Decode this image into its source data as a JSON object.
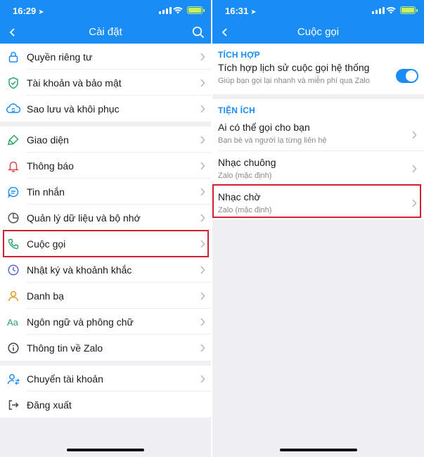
{
  "left": {
    "status": {
      "time": "16:29"
    },
    "title": "Cài đặt",
    "groups": [
      [
        {
          "label": "Quyền riêng tư",
          "icon": "lock-icon"
        },
        {
          "label": "Tài khoản và bảo mật",
          "icon": "shield-icon"
        },
        {
          "label": "Sao lưu và khôi phục",
          "icon": "cloud-sync-icon"
        }
      ],
      [
        {
          "label": "Giao diện",
          "icon": "brush-icon"
        },
        {
          "label": "Thông báo",
          "icon": "bell-icon"
        },
        {
          "label": "Tin nhắn",
          "icon": "chat-icon"
        },
        {
          "label": "Quản lý dữ liệu và bộ nhớ",
          "icon": "clock-storage-icon"
        },
        {
          "label": "Cuộc gọi",
          "icon": "phone-icon"
        },
        {
          "label": "Nhật ký và khoảnh khắc",
          "icon": "history-icon"
        },
        {
          "label": "Danh bạ",
          "icon": "contact-icon"
        },
        {
          "label": "Ngôn ngữ và phông chữ",
          "icon": "font-icon"
        },
        {
          "label": "Thông tin về Zalo",
          "icon": "info-icon"
        }
      ],
      [
        {
          "label": "Chuyển tài khoản",
          "icon": "switch-account-icon"
        },
        {
          "label": "Đăng xuất",
          "icon": "logout-icon"
        }
      ]
    ]
  },
  "right": {
    "status": {
      "time": "16:31"
    },
    "title": "Cuộc gọi",
    "sections": {
      "integration": {
        "title": "TÍCH HỢP",
        "item": {
          "title": "Tích hợp lịch sử cuộc gọi hệ thống",
          "subtitle": "Giúp bạn gọi lại nhanh và miễn phí qua Zalo",
          "toggle_on": true
        }
      },
      "utilities": {
        "title": "TIỆN ÍCH",
        "items": [
          {
            "title": "Ai có thể gọi cho bạn",
            "subtitle": "Bạn bè và người lạ từng liên hệ"
          },
          {
            "title": "Nhạc chuông",
            "subtitle": "Zalo (mặc định)"
          },
          {
            "title": "Nhạc chờ",
            "subtitle": "Zalo (mặc định)"
          }
        ]
      }
    }
  },
  "colors": {
    "accent": "#1a8cf5",
    "highlight": "#d32030",
    "icon": "#1a8cf5"
  }
}
